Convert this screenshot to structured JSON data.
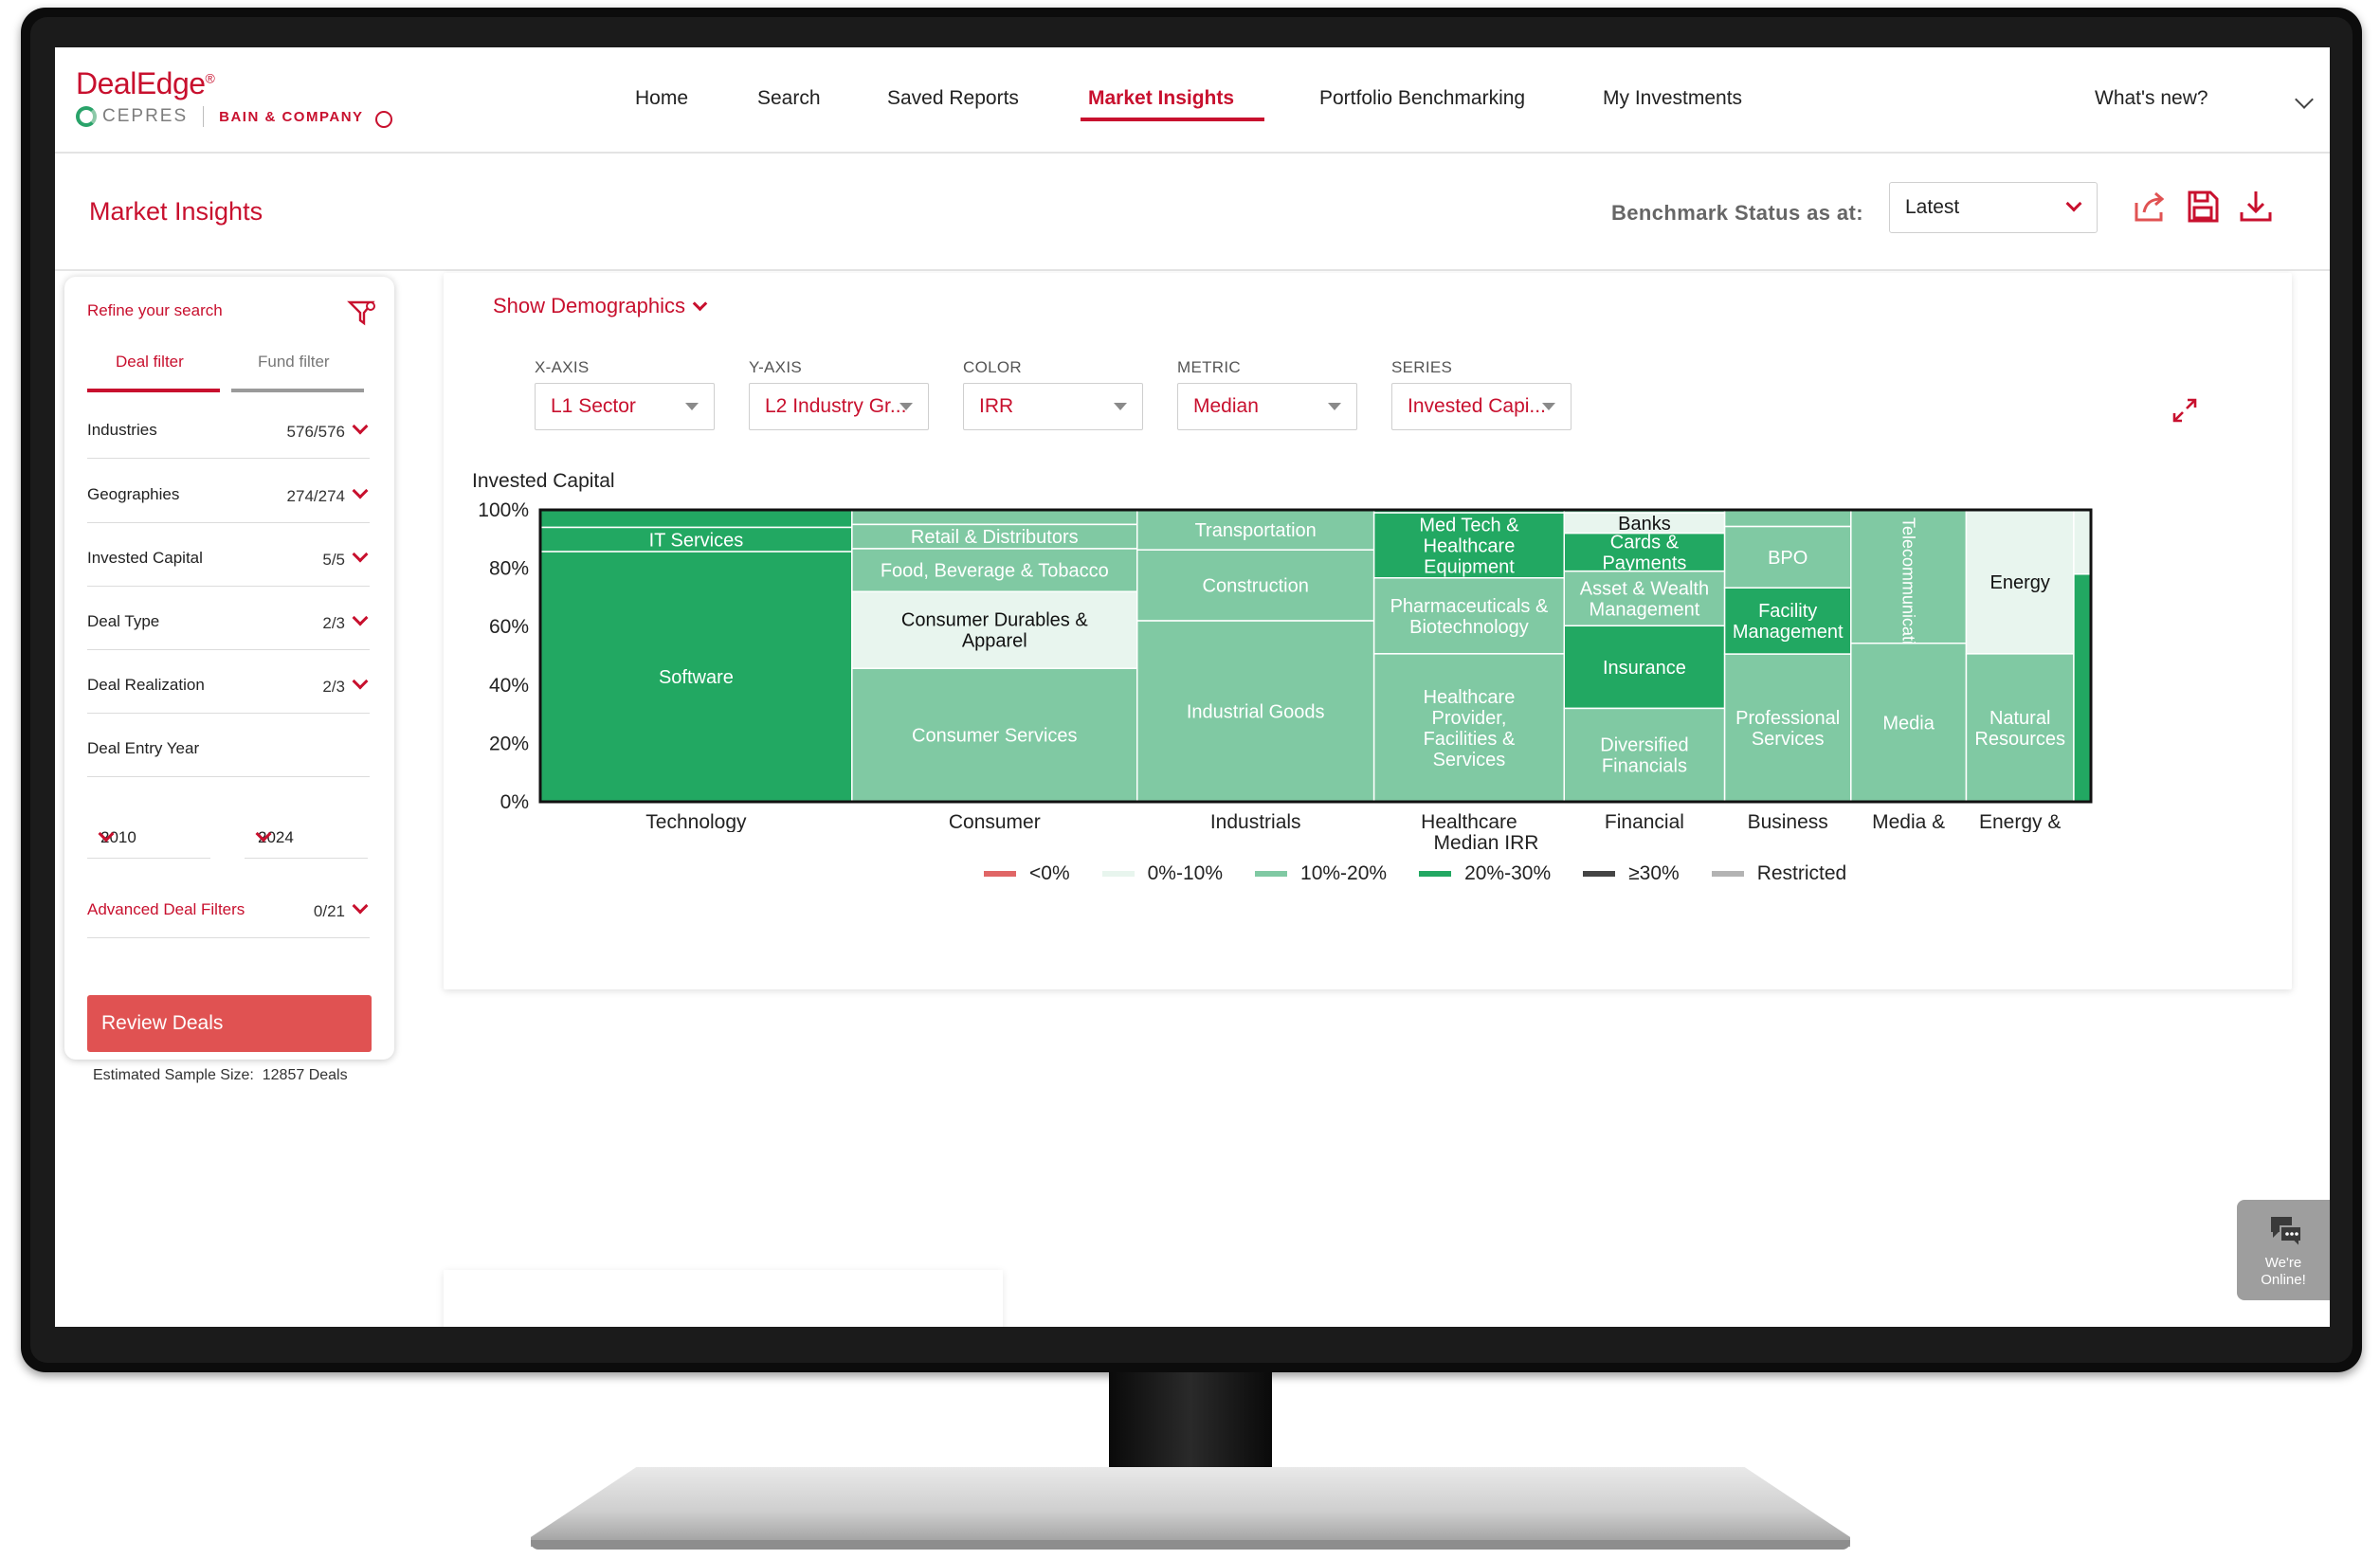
{
  "brand": {
    "name": "DealEdge",
    "mark": "®",
    "partner1": "CEPRES",
    "partner2": "BAIN & COMPANY"
  },
  "nav": {
    "items": [
      "Home",
      "Search",
      "Saved Reports",
      "Market Insights",
      "Portfolio Benchmarking",
      "My Investments"
    ],
    "active": "Market Insights",
    "whats_new": "What's new?"
  },
  "subheader": {
    "title": "Market Insights",
    "benchmark_label": "Benchmark Status as at:",
    "benchmark_value": "Latest"
  },
  "sidebar": {
    "title": "Refine your search",
    "tabs": [
      "Deal filter",
      "Fund filter"
    ],
    "filters": [
      {
        "label": "Industries",
        "count": "576/576"
      },
      {
        "label": "Geographies",
        "count": "274/274"
      },
      {
        "label": "Invested Capital",
        "count": "5/5"
      },
      {
        "label": "Deal Type",
        "count": "2/3"
      },
      {
        "label": "Deal Realization",
        "count": "2/3"
      },
      {
        "label": "Deal Entry Year",
        "count": ""
      }
    ],
    "year_from": "2010",
    "year_to": "2024",
    "advanced": {
      "label": "Advanced Deal Filters",
      "count": "0/21"
    },
    "review_button": "Review Deals",
    "sample_label": "Estimated Sample Size:",
    "sample_value": "12857 Deals"
  },
  "controls": {
    "show_demographics": "Show Demographics",
    "x_axis": {
      "label": "X-AXIS",
      "value": "L1 Sector"
    },
    "y_axis": {
      "label": "Y-AXIS",
      "value": "L2 Industry Gr..."
    },
    "color": {
      "label": "COLOR",
      "value": "IRR"
    },
    "metric": {
      "label": "METRIC",
      "value": "Median"
    },
    "series": {
      "label": "SERIES",
      "value": "Invested Capi..."
    }
  },
  "chart_data": {
    "type": "marimekko",
    "ylabel": "Invested Capital",
    "yticks": [
      "100%",
      "80%",
      "60%",
      "40%",
      "20%",
      "0%"
    ],
    "ylim": [
      0,
      100
    ],
    "color_metric": "Median IRR",
    "legend": [
      {
        "label": "<0%",
        "color": "#e06666"
      },
      {
        "label": "0%-10%",
        "color": "#e8f5ee"
      },
      {
        "label": "10%-20%",
        "color": "#80c9a3"
      },
      {
        "label": "20%-30%",
        "color": "#22a862"
      },
      {
        "label": "≥30%",
        "color": "#444444"
      },
      {
        "label": "Restricted",
        "color": "#b3b3b3"
      }
    ],
    "columns": [
      {
        "name": "Technology",
        "width_share": 20.0,
        "segments": [
          {
            "label": "",
            "share": 6,
            "band": "20%-30%"
          },
          {
            "label": "IT Services",
            "share": 8.3,
            "band": "20%-30%"
          },
          {
            "label": "Software",
            "share": 85.7,
            "band": "20%-30%"
          }
        ]
      },
      {
        "name": "Consumer",
        "width_share": 18.3,
        "segments": [
          {
            "label": "",
            "share": 5,
            "band": "10%-20%"
          },
          {
            "label": "Retail & Distributors",
            "share": 8.3,
            "band": "10%-20%"
          },
          {
            "label": "Food, Beverage & Tobacco",
            "share": 14.7,
            "band": "10%-20%"
          },
          {
            "label": "Consumer Durables & Apparel",
            "share": 26.3,
            "band": "0%-10%"
          },
          {
            "label": "Consumer Services",
            "share": 45.7,
            "band": "10%-20%"
          }
        ]
      },
      {
        "name": "Industrials",
        "width_share": 15.2,
        "segments": [
          {
            "label": "Transportation",
            "share": 13.7,
            "band": "10%-20%"
          },
          {
            "label": "Construction",
            "share": 24.3,
            "band": "10%-20%"
          },
          {
            "label": "Industrial Goods",
            "share": 62,
            "band": "10%-20%"
          }
        ]
      },
      {
        "name": "Healthcare",
        "width_share": 12.2,
        "segments": [
          {
            "label": "",
            "share": 1,
            "band": "20%-30%"
          },
          {
            "label": "Med Tech & Healthcare Equipment",
            "share": 22.3,
            "band": "20%-30%"
          },
          {
            "label": "Pharmaceuticals & Biotechnology",
            "share": 26,
            "band": "10%-20%"
          },
          {
            "label": "Healthcare Provider, Facilities & Services",
            "share": 50.7,
            "band": "10%-20%"
          }
        ]
      },
      {
        "name": "Financial Services",
        "width_share": 10.3,
        "segments": [
          {
            "label": "",
            "share": 1,
            "band": "10%-20%"
          },
          {
            "label": "Banks",
            "share": 7,
            "band": "0%-10%"
          },
          {
            "label": "Cards & Payments",
            "share": 13,
            "band": "20%-30%"
          },
          {
            "label": "Asset & Wealth Management",
            "share": 18.7,
            "band": "10%-20%"
          },
          {
            "label": "Insurance",
            "share": 28.3,
            "band": "20%-30%"
          },
          {
            "label": "Diversified Financials",
            "share": 32,
            "band": "10%-20%"
          }
        ]
      },
      {
        "name": "Business Services",
        "width_share": 8.1,
        "segments": [
          {
            "label": "",
            "share": 5.7,
            "band": "10%-20%"
          },
          {
            "label": "BPO",
            "share": 21,
            "band": "10%-20%"
          },
          {
            "label": "Facility Management",
            "share": 22.7,
            "band": "20%-30%"
          },
          {
            "label": "Professional Services",
            "share": 50.6,
            "band": "10%-20%"
          }
        ]
      },
      {
        "name": "Media & Telecom...",
        "width_share": 7.4,
        "segments": [
          {
            "label": "Telecommunication",
            "share": 45.7,
            "band": "10%-20%"
          },
          {
            "label": "Media",
            "share": 54.3,
            "band": "10%-20%"
          }
        ]
      },
      {
        "name": "Energy & Natural Resources",
        "width_share": 6.9,
        "segments": [
          {
            "label": "Energy",
            "share": 49.3,
            "band": "0%-10%"
          },
          {
            "label": "Natural Resources",
            "share": 50.7,
            "band": "10%-20%"
          }
        ]
      },
      {
        "name": "",
        "width_share": 1.1,
        "segments": [
          {
            "label": "",
            "share": 22,
            "band": "0%-10%"
          },
          {
            "label": "",
            "share": 78,
            "band": "20%-30%"
          }
        ]
      }
    ]
  },
  "chat": {
    "label1": "We're",
    "label2": "Online!"
  }
}
